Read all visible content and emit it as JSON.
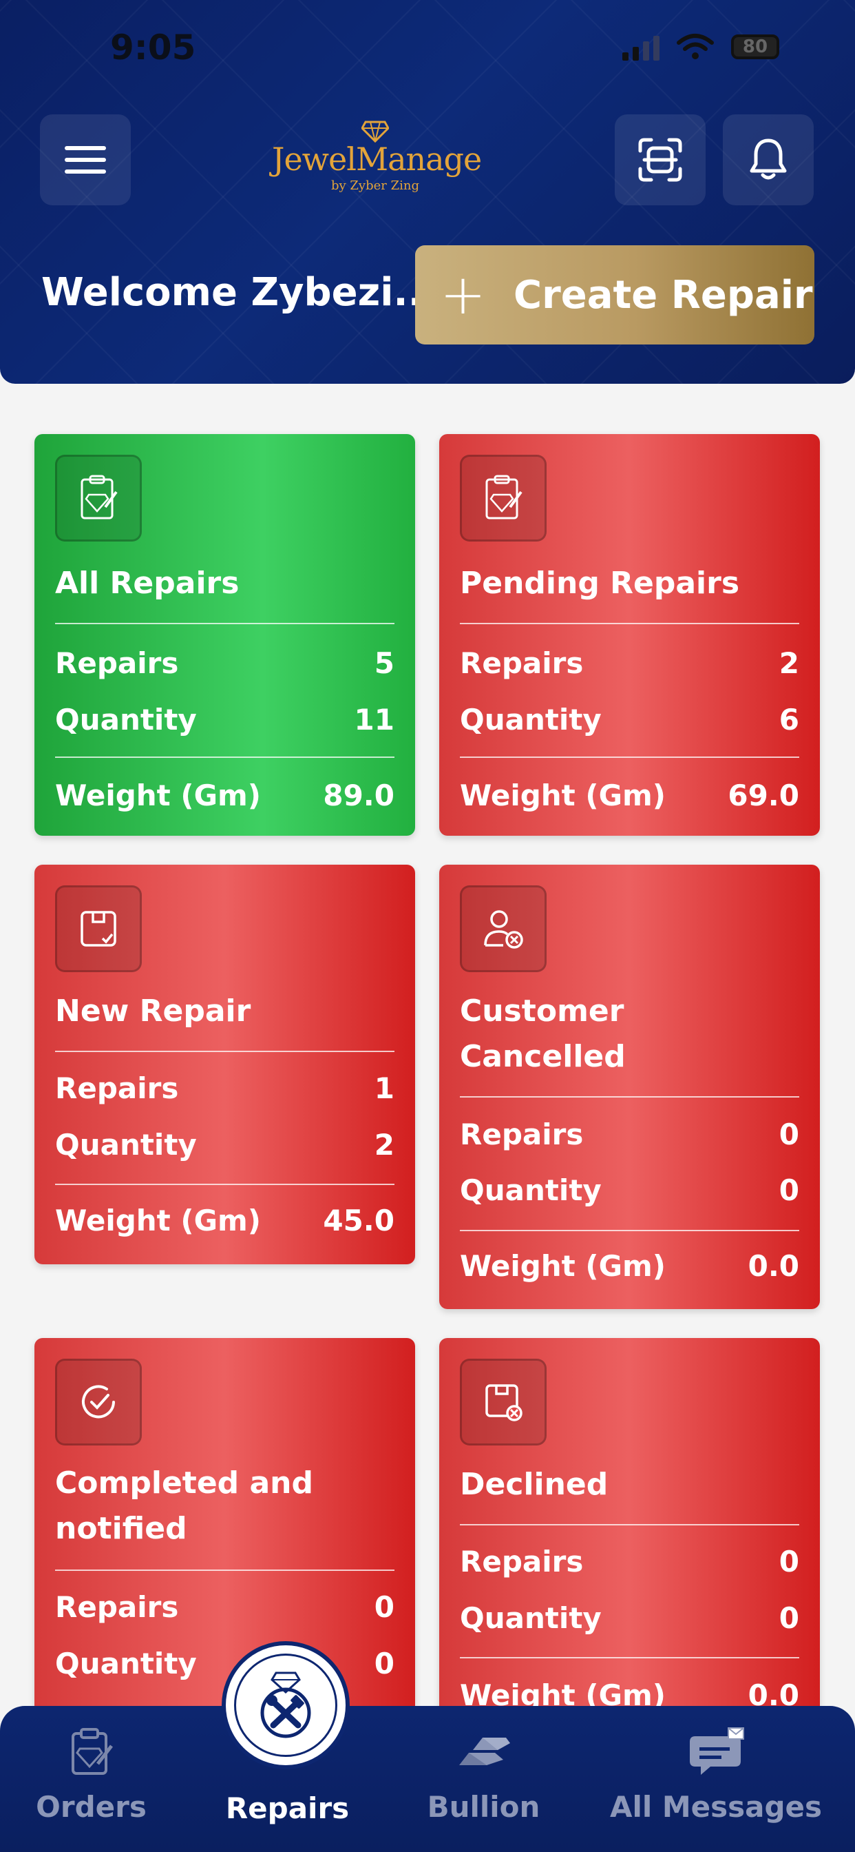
{
  "status_bar": {
    "time": "9:05",
    "battery": "80"
  },
  "header": {
    "logo_text": "JewelManage",
    "logo_sub": "by Zyber Zing",
    "welcome": "Welcome Zybezi...",
    "create_button": "Create Repair"
  },
  "cards": [
    {
      "title": "All Repairs",
      "repairs_label": "Repairs",
      "repairs": "5",
      "quantity_label": "Quantity",
      "quantity": "11",
      "weight_label": "Weight (Gm)",
      "weight": "89.0",
      "color": "#2ebd4f",
      "icon": "diamond-clipboard-icon"
    },
    {
      "title": "Pending Repairs",
      "repairs_label": "Repairs",
      "repairs": "2",
      "quantity_label": "Quantity",
      "quantity": "6",
      "weight_label": "Weight (Gm)",
      "weight": "69.0",
      "color": "#e03b3b",
      "icon": "diamond-clipboard-icon"
    },
    {
      "title": "New Repair",
      "repairs_label": "Repairs",
      "repairs": "1",
      "quantity_label": "Quantity",
      "quantity": "2",
      "weight_label": "Weight (Gm)",
      "weight": "45.0",
      "color": "#e03b3b",
      "icon": "box-check-icon"
    },
    {
      "title_line1": "Customer",
      "title_line2": "Cancelled",
      "repairs_label": "Repairs",
      "repairs": "0",
      "quantity_label": "Quantity",
      "quantity": "0",
      "weight_label": "Weight (Gm)",
      "weight": "0.0",
      "color": "#e03b3b",
      "icon": "user-cancel-icon"
    },
    {
      "title_line1": "Completed and",
      "title_line2": "notified",
      "repairs_label": "Repairs",
      "repairs": "0",
      "quantity_label": "Quantity",
      "quantity": "0",
      "color": "#e03b3b",
      "icon": "check-circle-icon"
    },
    {
      "title": "Declined",
      "repairs_label": "Repairs",
      "repairs": "0",
      "quantity_label": "Quantity",
      "quantity": "0",
      "weight_label": "Weight (Gm)",
      "weight": "0.0",
      "color": "#e03b3b",
      "icon": "box-cancel-icon"
    }
  ],
  "nav": {
    "items": [
      {
        "label": "Orders",
        "icon": "orders-icon"
      },
      {
        "label": "Repairs",
        "icon": "repairs-icon",
        "active": true
      },
      {
        "label": "Bullion",
        "icon": "bullion-icon"
      },
      {
        "label": "All Messages",
        "icon": "messages-icon"
      }
    ]
  },
  "colors": {
    "header_bg": "#0d2670",
    "gold": "#e3a43a",
    "green": "#2ebd4f",
    "red": "#e03b3b"
  }
}
